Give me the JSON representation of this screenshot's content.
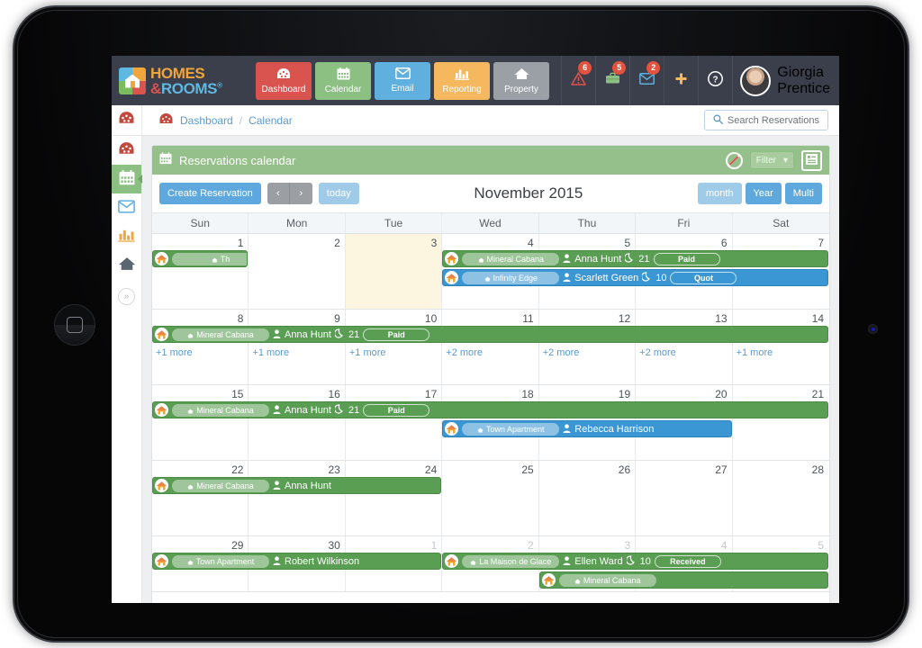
{
  "brand": {
    "line1": "HOMES",
    "line2_amp": "&",
    "line2": "ROOMS",
    "registered": "®"
  },
  "topnav": {
    "items": [
      {
        "label": "Dashboard",
        "icon": "gauge-icon",
        "glyph": "◔",
        "style": "nb-dashboard"
      },
      {
        "label": "Calendar",
        "icon": "calendar-icon",
        "glyph": "Ὄ5",
        "style": "nb-calendar"
      },
      {
        "label": "Email",
        "icon": "envelope-icon",
        "glyph": "✉",
        "style": "nb-email"
      },
      {
        "label": "Reporting",
        "icon": "bar-chart-icon",
        "glyph": "█",
        "style": "nb-reporting"
      },
      {
        "label": "Property",
        "icon": "house-icon",
        "glyph": "⌂",
        "style": "nb-property"
      }
    ],
    "icons": [
      {
        "name": "alert-icon",
        "glyph": "⚠",
        "badge": "6",
        "color": "#d9534f"
      },
      {
        "name": "briefcase-icon",
        "glyph": "Ὃc",
        "badge": "5",
        "color": "#8cbf82"
      },
      {
        "name": "mail-icon",
        "glyph": "✉",
        "badge": "2",
        "color": "#5fb0de"
      },
      {
        "name": "plus-icon",
        "glyph": "✚",
        "badge": "",
        "color": "#f5b85e"
      },
      {
        "name": "help-icon",
        "glyph": "?",
        "badge": "",
        "color": "#ffffff"
      }
    ],
    "user_name_line1": "Giorgia",
    "user_name_line2": "Prentice"
  },
  "breadcrumb": {
    "items": [
      "Dashboard",
      "Calendar"
    ],
    "separator": "/"
  },
  "search": {
    "placeholder": "Search Reservations",
    "label": "Search Reservations",
    "icon": "search-icon"
  },
  "sidebar": {
    "items": [
      {
        "name": "sidebar-item-dashboard",
        "icon": "gauge-icon",
        "glyph": "◔",
        "color": "#c3493f",
        "active": false
      },
      {
        "name": "sidebar-item-calendar",
        "icon": "calendar-icon",
        "glyph": "Ὄ5",
        "color": "#ffffff",
        "active": true
      },
      {
        "name": "sidebar-item-email",
        "icon": "envelope-icon",
        "glyph": "✉",
        "color": "#5fb0de",
        "active": false
      },
      {
        "name": "sidebar-item-reporting",
        "icon": "bar-chart-icon",
        "glyph": "█",
        "color": "#f0a63c",
        "active": false
      },
      {
        "name": "sidebar-item-property",
        "icon": "house-icon",
        "glyph": "⌂",
        "color": "#5a6671",
        "active": false
      }
    ],
    "expand_glyph": "»"
  },
  "panel": {
    "title": "Reservations calendar",
    "title_icon": "calendar-icon",
    "ban_icon": "no-entry-icon",
    "filter_label": "Filter",
    "filter_caret": "▾",
    "list_icon": "list-view-icon",
    "list_glyph": "☰"
  },
  "toolbar": {
    "create_label": "Create Reservation",
    "prev_glyph": "‹",
    "next_glyph": "›",
    "today_label": "today",
    "title": "November 2015",
    "views": [
      "month",
      "Year",
      "Multi"
    ],
    "active_view": "month"
  },
  "calendar": {
    "dow": [
      "Sun",
      "Mon",
      "Tue",
      "Wed",
      "Thu",
      "Fri",
      "Sat"
    ],
    "weeks": [
      {
        "days": [
          {
            "num": "1",
            "other": false,
            "today": false
          },
          {
            "num": "2",
            "other": false,
            "today": false
          },
          {
            "num": "3",
            "other": false,
            "today": true
          },
          {
            "num": "4",
            "other": false,
            "today": false
          },
          {
            "num": "5",
            "other": false,
            "today": false
          },
          {
            "num": "6",
            "other": false,
            "today": false
          },
          {
            "num": "7",
            "other": false,
            "today": false
          }
        ],
        "more": [],
        "events": [
          {
            "color": "green",
            "start": 0,
            "span": 1,
            "row": 0,
            "property": "Th",
            "guest": "",
            "nights": "",
            "status": "",
            "clipped": true
          },
          {
            "color": "green",
            "start": 3,
            "span": 4,
            "row": 0,
            "property": "Mineral Cabana",
            "guest": "Anna Hunt",
            "nights": "21",
            "status": "Paid"
          },
          {
            "color": "blue",
            "start": 3,
            "span": 4,
            "row": 1,
            "property": "Infinity Edge",
            "guest": "Scarlett Green",
            "nights": "10",
            "status": "Quot"
          }
        ]
      },
      {
        "days": [
          {
            "num": "8",
            "other": false,
            "today": false
          },
          {
            "num": "9",
            "other": false,
            "today": false
          },
          {
            "num": "10",
            "other": false,
            "today": false
          },
          {
            "num": "11",
            "other": false,
            "today": false
          },
          {
            "num": "12",
            "other": false,
            "today": false
          },
          {
            "num": "13",
            "other": false,
            "today": false
          },
          {
            "num": "14",
            "other": false,
            "today": false
          }
        ],
        "more": [
          "+1 more",
          "+1 more",
          "+1 more",
          "+2 more",
          "+2 more",
          "+2 more",
          "+1 more"
        ],
        "events": [
          {
            "color": "green",
            "start": 0,
            "span": 7,
            "row": 0,
            "property": "Mineral Cabana",
            "guest": "Anna Hunt",
            "nights": "21",
            "status": "Paid"
          }
        ]
      },
      {
        "days": [
          {
            "num": "15",
            "other": false,
            "today": false
          },
          {
            "num": "16",
            "other": false,
            "today": false
          },
          {
            "num": "17",
            "other": false,
            "today": false
          },
          {
            "num": "18",
            "other": false,
            "today": false
          },
          {
            "num": "19",
            "other": false,
            "today": false
          },
          {
            "num": "20",
            "other": false,
            "today": false
          },
          {
            "num": "21",
            "other": false,
            "today": false
          }
        ],
        "more": [],
        "events": [
          {
            "color": "green",
            "start": 0,
            "span": 7,
            "row": 0,
            "property": "Mineral Cabana",
            "guest": "Anna Hunt",
            "nights": "21",
            "status": "Paid"
          },
          {
            "color": "blue",
            "start": 3,
            "span": 3,
            "row": 1,
            "property": "Town Apartment",
            "guest": "Rebecca Harrison",
            "nights": "",
            "status": "",
            "clipped": true
          }
        ]
      },
      {
        "days": [
          {
            "num": "22",
            "other": false,
            "today": false
          },
          {
            "num": "23",
            "other": false,
            "today": false
          },
          {
            "num": "24",
            "other": false,
            "today": false
          },
          {
            "num": "25",
            "other": false,
            "today": false
          },
          {
            "num": "26",
            "other": false,
            "today": false
          },
          {
            "num": "27",
            "other": false,
            "today": false
          },
          {
            "num": "28",
            "other": false,
            "today": false
          }
        ],
        "more": [],
        "events": [
          {
            "color": "green",
            "start": 0,
            "span": 3,
            "row": 0,
            "property": "Mineral Cabana",
            "guest": "Anna Hunt",
            "nights": "",
            "status": "",
            "clipped": true
          }
        ]
      },
      {
        "days": [
          {
            "num": "29",
            "other": false,
            "today": false
          },
          {
            "num": "30",
            "other": false,
            "today": false
          },
          {
            "num": "1",
            "other": true,
            "today": false
          },
          {
            "num": "2",
            "other": true,
            "today": false
          },
          {
            "num": "3",
            "other": true,
            "today": false
          },
          {
            "num": "4",
            "other": true,
            "today": false
          },
          {
            "num": "5",
            "other": true,
            "today": false
          }
        ],
        "more": [],
        "events": [
          {
            "color": "green",
            "start": 0,
            "span": 3,
            "row": 0,
            "property": "Town Apartment",
            "guest": "Robert Wilkinson",
            "nights": "",
            "status": "",
            "clipped": true
          },
          {
            "color": "green",
            "start": 3,
            "span": 4,
            "row": 0,
            "property": "La Maison de Glace",
            "guest": "Ellen Ward",
            "nights": "10",
            "status": "Received"
          },
          {
            "color": "green",
            "start": 4,
            "span": 3,
            "row": 1,
            "property": "Mineral Cabana",
            "guest": "",
            "nights": "",
            "status": "",
            "clipped": true
          }
        ]
      }
    ],
    "event_icons": {
      "property": "house-icon",
      "property_glyph": "⌂",
      "guest": "user-icon",
      "guest_glyph": "♟",
      "nights": "moon-icon",
      "nights_glyph": "☾",
      "avatar": "property-avatar-icon",
      "avatar_glyph": "⌂"
    }
  },
  "colors": {
    "navbar": "#3a3f4b",
    "brand_orange": "#f0a63c",
    "brand_blue": "#5fb0de",
    "accent_green": "#8cbf82",
    "accent_red": "#d9534f",
    "event_green": "#5a9e54",
    "event_blue": "#3b97d3",
    "today_highlight": "#fcf5e0",
    "link_blue": "#5b9bd5"
  }
}
